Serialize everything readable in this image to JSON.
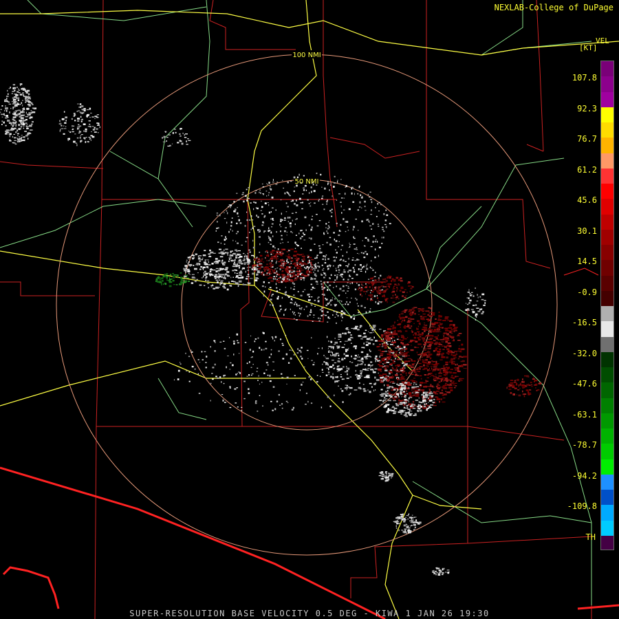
{
  "header": {
    "credit": "NEXLAB-College of DuPage",
    "product_code": "VEL",
    "units": "[KT]"
  },
  "footer": {
    "caption": "SUPER-RESOLUTION BASE VELOCITY 0.5 DEG - KIWA 1 JAN 26 19:30"
  },
  "range_rings": [
    {
      "label": "100 NMI"
    },
    {
      "label": "50 NMI"
    }
  ],
  "legend": {
    "ticks": [
      "107.8",
      "92.3",
      "76.7",
      "61.2",
      "45.6",
      "30.1",
      "14.5",
      "-0.9",
      "-16.5",
      "-32.0",
      "-47.6",
      "-63.1",
      "-78.7",
      "-94.2",
      "-109.8",
      "TH"
    ],
    "colors": [
      "#7a0078",
      "#8c008c",
      "#a000a0",
      "#ffff00",
      "#ffdc00",
      "#ffb400",
      "#ff9966",
      "#ff3333",
      "#ff0000",
      "#e00000",
      "#c00000",
      "#a00000",
      "#880000",
      "#700000",
      "#5a0000",
      "#440000",
      "#b0b0b0",
      "#e8e8e8",
      "#707070",
      "#003300",
      "#004d00",
      "#006600",
      "#008000",
      "#009900",
      "#00b300",
      "#00cc00",
      "#00ee00",
      "#1e90ff",
      "#0050c8",
      "#00aaff",
      "#00ccff",
      "#440044"
    ]
  },
  "map_colors": {
    "state_border": "#ff2222",
    "county_line": "#cc2222",
    "highway": "#ffff44",
    "road": "#88dd88",
    "range_ring": "#e89a7a",
    "ring_label": "#ffff44"
  }
}
